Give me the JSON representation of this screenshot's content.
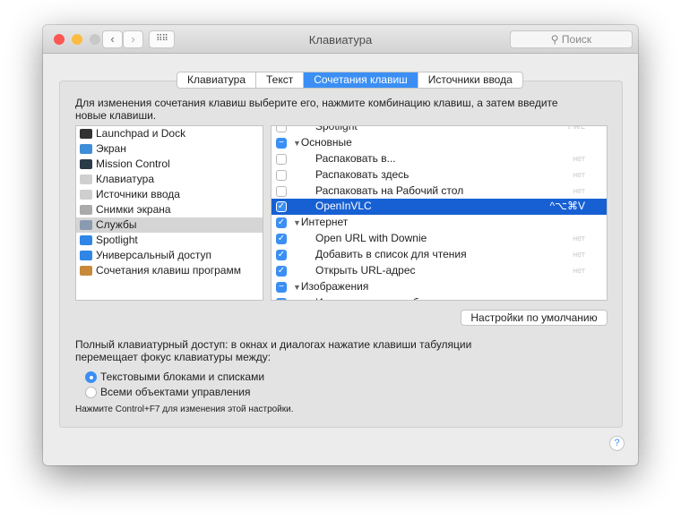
{
  "window": {
    "title": "Клавиатура",
    "search_placeholder": "Поиск",
    "search_icon": "magnifier"
  },
  "tabs": [
    {
      "label": "Клавиатура",
      "active": false
    },
    {
      "label": "Текст",
      "active": false
    },
    {
      "label": "Сочетания клавиш",
      "active": true
    },
    {
      "label": "Источники ввода",
      "active": false
    }
  ],
  "description": "Для изменения сочетания клавиш выберите его, нажмите комбинацию клавиш, а затем введите новые клавиши.",
  "categories": [
    {
      "label": "Launchpad и Dock",
      "icon": "launchpad-icon",
      "color": "#333333"
    },
    {
      "label": "Экран",
      "icon": "display-icon",
      "color": "#3d8ed8"
    },
    {
      "label": "Mission Control",
      "icon": "mission-control-icon",
      "color": "#2a3b4a"
    },
    {
      "label": "Клавиатура",
      "icon": "keyboard-icon",
      "color": "#cfcfcf"
    },
    {
      "label": "Источники ввода",
      "icon": "keyboard-icon",
      "color": "#cfcfcf"
    },
    {
      "label": "Снимки экрана",
      "icon": "screenshot-icon",
      "color": "#aaaaaa"
    },
    {
      "label": "Службы",
      "icon": "gear-icon",
      "color": "#8a9bb0",
      "selected": true
    },
    {
      "label": "Spotlight",
      "icon": "spotlight-icon",
      "color": "#2f86e6"
    },
    {
      "label": "Универсальный доступ",
      "icon": "accessibility-icon",
      "color": "#2f86e6"
    },
    {
      "label": "Сочетания клавиш программ",
      "icon": "app-shortcuts-icon",
      "color": "#c78a3a"
    }
  ],
  "services": [
    {
      "label": "Spotlight",
      "shortcut": "⇧⌘L",
      "state": "off",
      "group": false
    },
    {
      "label": "Основные",
      "state": "mixed",
      "group": true
    },
    {
      "label": "Распаковать в...",
      "shortcut": "нет",
      "state": "off",
      "group": false
    },
    {
      "label": "Распаковать здесь",
      "shortcut": "нет",
      "state": "off",
      "group": false
    },
    {
      "label": "Распаковать на Рабочий стол",
      "shortcut": "нет",
      "state": "off",
      "group": false
    },
    {
      "label": "OpenInVLC",
      "shortcut": "^⌥⌘V",
      "state": "on",
      "group": false,
      "selected": true
    },
    {
      "label": "Интернет",
      "state": "on",
      "group": true
    },
    {
      "label": "Open URL with Downie",
      "shortcut": "нет",
      "state": "on",
      "group": false
    },
    {
      "label": "Добавить в список для чтения",
      "shortcut": "нет",
      "state": "on",
      "group": false
    },
    {
      "label": "Открыть URL-адрес",
      "shortcut": "нет",
      "state": "on",
      "group": false
    },
    {
      "label": "Изображения",
      "state": "mixed",
      "group": true
    },
    {
      "label": "Импортировать изображение",
      "shortcut": "нет",
      "state": "on",
      "group": false
    }
  ],
  "defaults_button": "Настройки по умолчанию",
  "keyboard_access": "Полный клавиатурный доступ: в окнах и диалогах нажатие клавиши табуляции перемещает фокус клавиатуры между:",
  "radios": [
    {
      "label": "Текстовыми блоками и списками",
      "checked": true
    },
    {
      "label": "Всеми объектами управления",
      "checked": false
    }
  ],
  "note": "Нажмите Control+F7 для изменения этой настройки.",
  "help": "?"
}
